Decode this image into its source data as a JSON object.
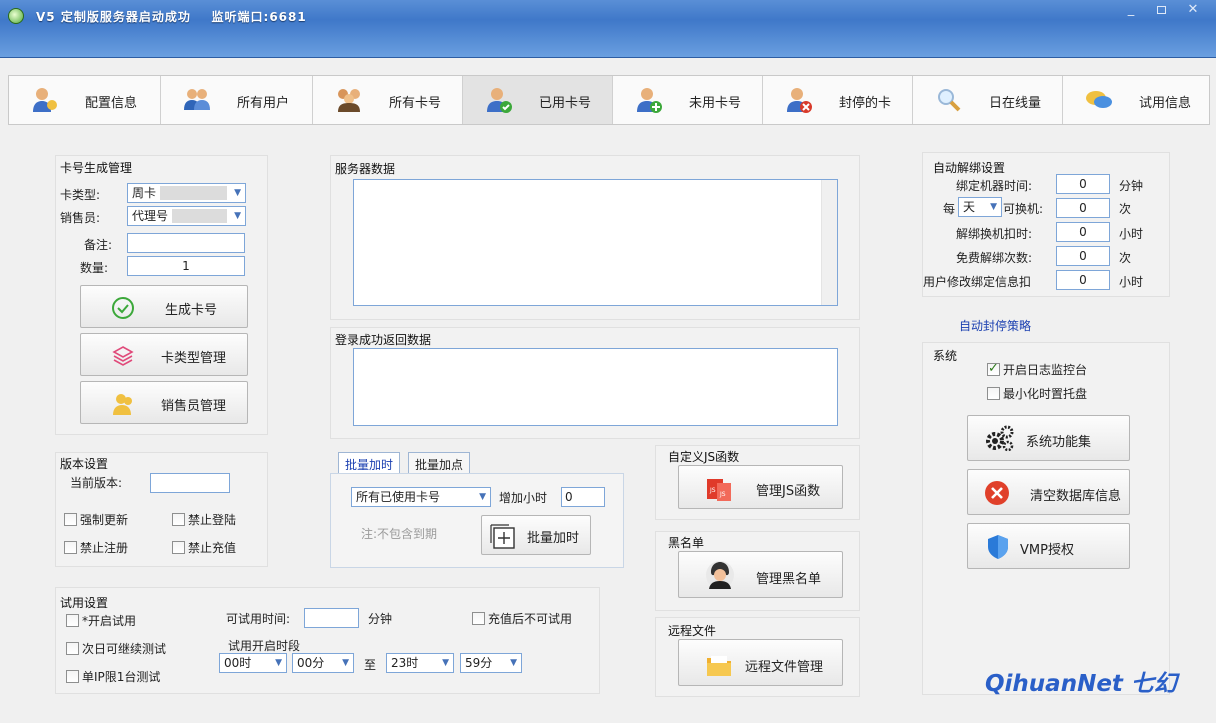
{
  "window": {
    "title": "V5 定制版服务器启动成功    监听端口:6681",
    "minimize": "_",
    "close": "✕"
  },
  "tabs": [
    {
      "label": "配置信息",
      "icon": "users-config-icon"
    },
    {
      "label": "所有用户",
      "icon": "users-icon"
    },
    {
      "label": "所有卡号",
      "icon": "group-icon"
    },
    {
      "label": "已用卡号",
      "icon": "user-check-icon"
    },
    {
      "label": "未用卡号",
      "icon": "user-add-icon"
    },
    {
      "label": "封停的卡",
      "icon": "user-block-icon"
    },
    {
      "label": "日在线量",
      "icon": "search-icon"
    },
    {
      "label": "试用信息",
      "icon": "chat-icon"
    }
  ],
  "card_gen": {
    "title": "卡号生成管理",
    "type_label": "卡类型:",
    "type_value": "周卡",
    "seller_label": "销售员:",
    "seller_value": "代理号",
    "note_label": "备注:",
    "note_value": "",
    "qty_label": "数量:",
    "qty_value": "1",
    "generate_btn": "生成卡号",
    "type_mgmt_btn": "卡类型管理",
    "seller_mgmt_btn": "销售员管理"
  },
  "version": {
    "title": "版本设置",
    "current_label": "当前版本:",
    "current_value": "",
    "force_update": "强制更新",
    "forbid_login": "禁止登陆",
    "forbid_register": "禁止注册",
    "forbid_recharge": "禁止充值"
  },
  "trial": {
    "title": "试用设置",
    "enable": "*开启试用",
    "next_day": "次日可继续测试",
    "single_ip": "单IP限1台测试",
    "time_label": "可试用时间:",
    "time_value": "",
    "time_unit": "分钟",
    "no_trial_after_recharge": "充值后不可试用",
    "period_label": "试用开启时段",
    "start_hour": "00时",
    "start_min": "00分",
    "to": "至",
    "end_hour": "23时",
    "end_min": "59分"
  },
  "server": {
    "title": "服务器数据",
    "login_title": "登录成功返回数据"
  },
  "batch": {
    "tab1": "批量加时",
    "tab2": "批量加点",
    "scope_value": "所有已使用卡号",
    "add_hours_label": "增加小时",
    "add_hours_value": "0",
    "note": "注:不包含到期",
    "batch_btn": "批量加时"
  },
  "custom_js": {
    "title": "自定义JS函数",
    "btn": "管理JS函数"
  },
  "blacklist": {
    "title": "黑名单",
    "btn": "管理黑名单"
  },
  "remote": {
    "title": "远程文件",
    "btn": "远程文件管理"
  },
  "unbind": {
    "title": "自动解绑设置",
    "bind_time_label": "绑定机器时间:",
    "bind_time_value": "0",
    "bind_time_unit": "分钟",
    "every_label": "每",
    "every_value": "天",
    "change_label": "可换机:",
    "change_value": "0",
    "change_unit": "次",
    "deduct_label": "解绑换机扣时:",
    "deduct_value": "0",
    "deduct_unit": "小时",
    "free_label": "免费解绑次数:",
    "free_value": "0",
    "free_unit": "次",
    "modify_label": "用户修改绑定信息扣",
    "modify_value": "0",
    "modify_unit": "小时"
  },
  "auto_ban": "自动封停策略",
  "system": {
    "title": "系统",
    "log_console": "开启日志监控台",
    "minimize_tray": "最小化时置托盘",
    "func_btn": "系统功能集",
    "clear_btn": "清空数据库信息",
    "vmp_btn": "VMP授权"
  },
  "watermark": "QihuanNet 七幻",
  "colors": {
    "accent": "#2a5fc8",
    "title_bar": "#4a80cf"
  }
}
